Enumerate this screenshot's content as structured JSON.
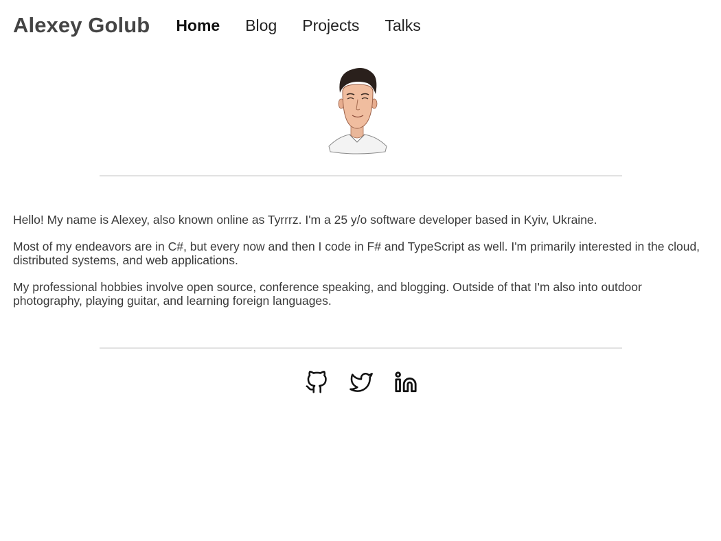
{
  "header": {
    "brand": "Alexey Golub",
    "nav": [
      {
        "label": "Home",
        "active": true
      },
      {
        "label": "Blog",
        "active": false
      },
      {
        "label": "Projects",
        "active": false
      },
      {
        "label": "Talks",
        "active": false
      }
    ]
  },
  "about": {
    "paragraphs": [
      "Hello! My name is Alexey, also known online as Tyrrrz. I'm a 25 y/o software developer based in Kyiv, Ukraine.",
      "Most of my endeavors are in C#, but every now and then I code in F# and TypeScript as well. I'm primarily interested in the cloud, distributed systems, and web applications.",
      "My professional hobbies involve open source, conference speaking, and blogging. Outside of that I'm also into outdoor photography, playing guitar, and learning foreign languages."
    ]
  },
  "social": [
    {
      "icon": "github-icon"
    },
    {
      "icon": "twitter-icon"
    },
    {
      "icon": "linkedin-icon"
    }
  ],
  "colors": {
    "text": "#3a3a3a",
    "brand": "#444444",
    "divider": "#e2e2e2",
    "background": "#ffffff"
  }
}
